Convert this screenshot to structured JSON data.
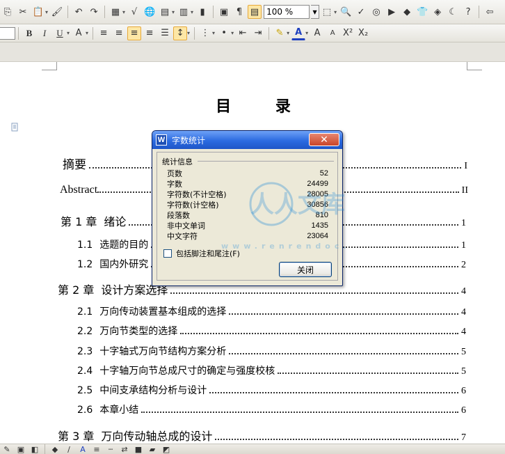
{
  "toolbar": {
    "zoom_value": "100 %"
  },
  "document": {
    "toc_title": "目  录",
    "entries": [
      {
        "level": 0,
        "number": "",
        "text": "摘要",
        "page": "I"
      },
      {
        "level": 0,
        "number": "",
        "text": "Abstract",
        "page": "II"
      },
      {
        "level": 0,
        "number": "第 1 章",
        "text": "绪论",
        "page": "1"
      },
      {
        "level": 1,
        "number": "1.1",
        "text": "选题的目的",
        "page": "1"
      },
      {
        "level": 1,
        "number": "1.2",
        "text": "国内外研究",
        "page": "2"
      },
      {
        "level": 0,
        "number": "第 2 章",
        "text": "设计方案选择",
        "page": "4"
      },
      {
        "level": 1,
        "number": "2.1",
        "text": "万向传动装置基本组成的选择",
        "page": "4"
      },
      {
        "level": 1,
        "number": "2.2",
        "text": "万向节类型的选择",
        "page": "4"
      },
      {
        "level": 1,
        "number": "2.3",
        "text": "十字轴式万向节结构方案分析",
        "page": "5"
      },
      {
        "level": 1,
        "number": "2.4",
        "text": "十字轴万向节总成尺寸的确定与强度校核",
        "page": "5"
      },
      {
        "level": 1,
        "number": "2.5",
        "text": "中间支承结构分析与设计",
        "page": "6"
      },
      {
        "level": 1,
        "number": "2.6",
        "text": "本章小结",
        "page": "6"
      },
      {
        "level": 0,
        "number": "第 3 章",
        "text": "万向传动轴总成的设计",
        "page": "7"
      }
    ]
  },
  "dialog": {
    "title": "字数统计",
    "logo": "W",
    "close_x": "✕",
    "group_label": "统计信息",
    "stats": [
      {
        "label": "页数",
        "value": "52"
      },
      {
        "label": "字数",
        "value": "24499"
      },
      {
        "label": "字符数(不计空格)",
        "value": "28005"
      },
      {
        "label": "字符数(计空格)",
        "value": "30856"
      },
      {
        "label": "段落数",
        "value": "810"
      },
      {
        "label": "非中文单词",
        "value": "1435"
      },
      {
        "label": "中文字符",
        "value": "23064"
      }
    ],
    "checkbox_label": "包括脚注和尾注(F)",
    "checkbox_checked": false,
    "close_button": "关闭"
  },
  "watermark": {
    "text": "人人文库",
    "url": "www.renrendoc.com"
  },
  "colors": {
    "title_bar": "#2b6ae0",
    "dialog_bg": "#ece9d8",
    "active_button": "#fde7a6"
  }
}
